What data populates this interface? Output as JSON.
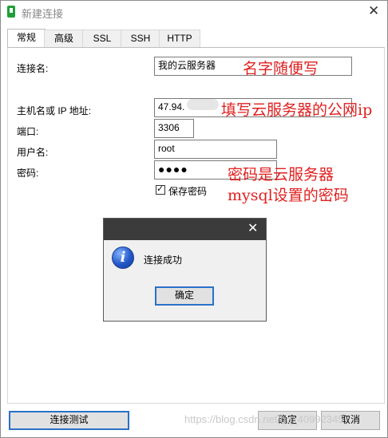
{
  "window": {
    "title": "新建连接",
    "close_glyph": "✕"
  },
  "tabs": [
    {
      "label": "常规",
      "active": true
    },
    {
      "label": "高级"
    },
    {
      "label": "SSL"
    },
    {
      "label": "SSH"
    },
    {
      "label": "HTTP"
    }
  ],
  "form": {
    "connection_name_label": "连接名:",
    "connection_name_value": "我的云服务器",
    "host_label": "主机名或 IP 地址:",
    "host_value": "47.94.",
    "port_label": "端口:",
    "port_value": "3306",
    "username_label": "用户名:",
    "username_value": "root",
    "password_label": "密码:",
    "password_value": "●●●●",
    "save_password_label": "保存密码",
    "save_password_checked": true
  },
  "annotations": {
    "name_hint": "名字随便写",
    "host_hint": "填写云服务器的公网ip",
    "password_hint_line1": "密码是云服务器",
    "password_hint_line2": "mysql设置的密码",
    "color": "#e02020"
  },
  "dialog": {
    "close_glyph": "✕",
    "icon": "info-icon",
    "message": "连接成功",
    "ok_label": "确定"
  },
  "footer": {
    "test_label": "连接测试",
    "ok_label": "确定",
    "cancel_label": "取消"
  },
  "watermark": "https://blog.csdn.net/qq_40992345"
}
